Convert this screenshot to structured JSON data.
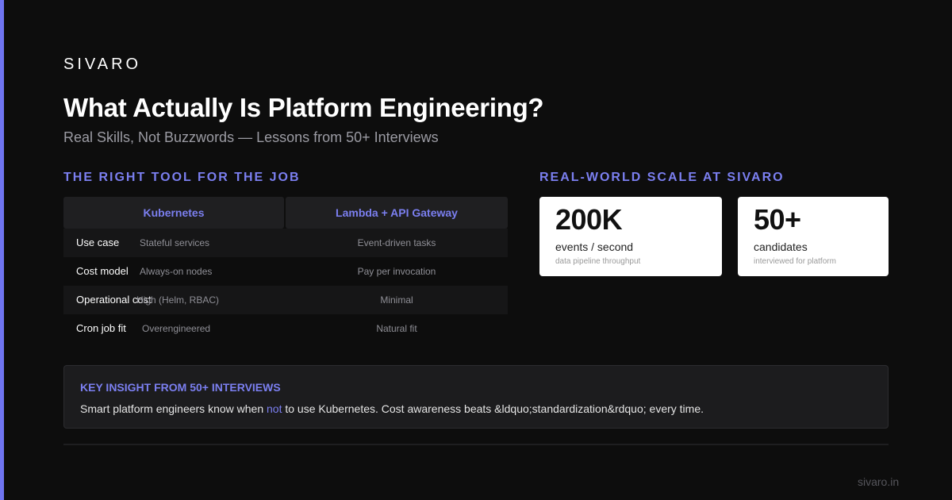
{
  "brand": "SIVARO",
  "title": "What Actually Is Platform Engineering?",
  "subtitle": "Real Skills, Not Buzzwords — Lessons from 50+ Interviews",
  "comparison": {
    "heading": "THE RIGHT TOOL FOR THE JOB",
    "columns": [
      "Kubernetes",
      "Lambda + API Gateway"
    ],
    "rows": [
      {
        "label": "Use case",
        "kubernetes": "Stateful services",
        "lambda": "Event-driven tasks"
      },
      {
        "label": "Cost model",
        "kubernetes": "Always-on nodes",
        "lambda": "Pay per invocation"
      },
      {
        "label": "Operational cost",
        "kubernetes": "High (Helm, RBAC)",
        "lambda": "Minimal"
      },
      {
        "label": "Cron job fit",
        "kubernetes": "Overengineered",
        "lambda": "Natural fit"
      }
    ]
  },
  "scale": {
    "heading": "REAL-WORLD SCALE AT SIVARO",
    "stats": [
      {
        "value": "200K",
        "label": "events / second",
        "description": "data pipeline throughput"
      },
      {
        "value": "50+",
        "label": "candidates",
        "description": "interviewed for platform"
      }
    ]
  },
  "insight": {
    "title": "KEY INSIGHT FROM 50+ INTERVIEWS",
    "text_before": "Smart platform engineers know when ",
    "highlight": "not",
    "text_after": " to use Kubernetes. Cost awareness beats &ldquo;standardization&rdquo; every time."
  },
  "footer": "sivaro.in",
  "colors": {
    "accent": "#6f74f0",
    "background": "#0d0d0d",
    "card": "#ffffff"
  }
}
